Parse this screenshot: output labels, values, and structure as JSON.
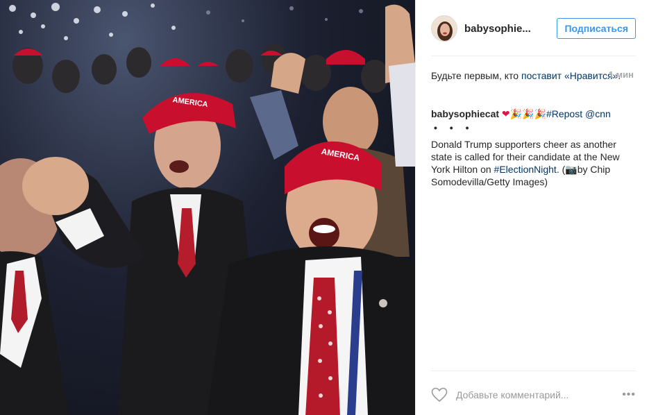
{
  "photo": {
    "alt": "",
    "cap_text_1": "AMERICA",
    "cap_text_2": "AMERICA"
  },
  "header": {
    "username": "babysophie...",
    "follow_label": "Подписаться"
  },
  "likes": {
    "prefix": "Будьте первым, кто ",
    "link": "поставит «Нравится»",
    "suffix": ".",
    "time": "1 мин"
  },
  "caption": {
    "author": "babysophiecat",
    "heart": "❤",
    "party": "🎉🎉🎉",
    "hashtag_repost": "#Repost",
    "mention": "@cnn",
    "dots": "• • •",
    "text_1": "Donald Trump supporters cheer as another state is called for their candidate at the New York Hilton on ",
    "hashtag_election": "#ElectionNight",
    "text_2": ". (",
    "camera": "📷",
    "text_3": "by Chip Somodevilla/Getty Images)"
  },
  "comment": {
    "placeholder": "Добавьте комментарий...",
    "more": "•••"
  },
  "colors": {
    "follow_blue": "#3897f0",
    "link_navy": "#003569",
    "cap_red": "#c8102e",
    "divider": "#efefef"
  },
  "icons": {
    "like": "heart-outline-icon",
    "more": "more-options-icon"
  }
}
